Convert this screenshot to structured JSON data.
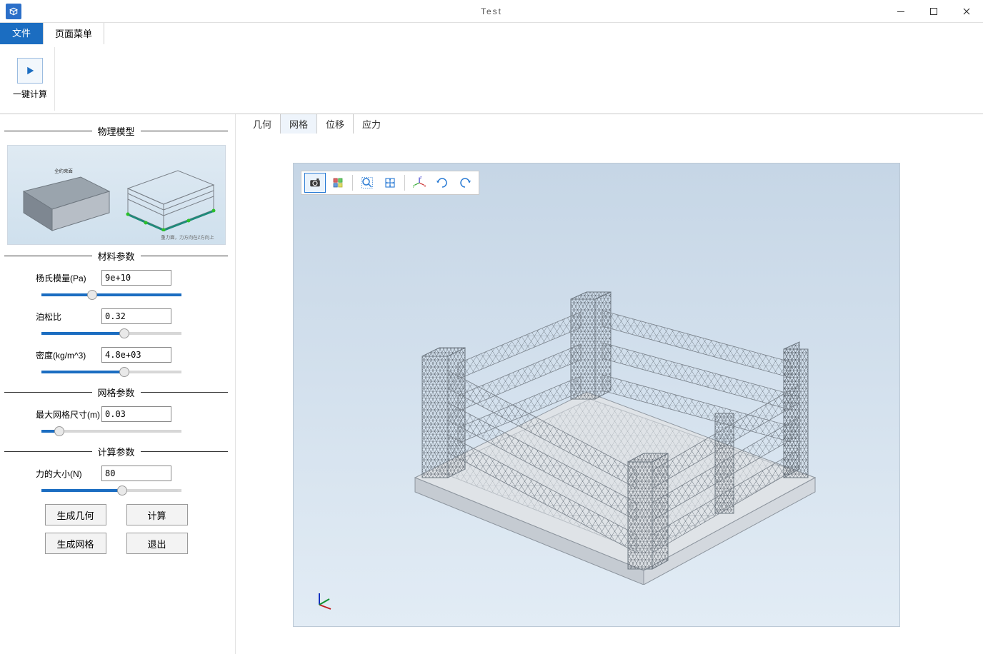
{
  "window": {
    "title": "Test",
    "min_tooltip": "Minimize",
    "max_tooltip": "Maximize",
    "close_tooltip": "Close"
  },
  "menu": {
    "file": "文件",
    "page_menu": "页面菜单"
  },
  "ribbon": {
    "one_click_calc": "一键计算"
  },
  "sidebar": {
    "sections": {
      "physics": "物理模型",
      "material": "材料参数",
      "mesh": "网格参数",
      "calc": "计算参数"
    },
    "preview_caption": "重力面，力方向在Z方向上",
    "preview_top_label": "全约束面",
    "params": {
      "youngs_label": "杨氏模量(Pa)",
      "youngs_value": "9e+10",
      "poisson_label": "泊松比",
      "poisson_value": "0.32",
      "density_label": "密度(kg/m^3)",
      "density_value": "4.8e+03",
      "maxmesh_label": "最大网格尺寸(m)",
      "maxmesh_value": "0.03",
      "force_label": "力的大小(N)",
      "force_value": "80"
    },
    "buttons": {
      "gen_geometry": "生成几何",
      "calc": "计算",
      "gen_mesh": "生成网格",
      "exit": "退出"
    }
  },
  "viewtabs": {
    "geometry": "几何",
    "mesh": "网格",
    "displacement": "位移",
    "stress": "应力",
    "active": "mesh"
  },
  "toolbar3d": {
    "camera": "camera-icon",
    "select": "select-icon",
    "zoom_rect": "zoom-rect-icon",
    "pan": "pan-icon",
    "axes": "axes-icon",
    "rotate_cw": "rotate-cw-icon",
    "rotate_ccw": "rotate-ccw-icon"
  }
}
